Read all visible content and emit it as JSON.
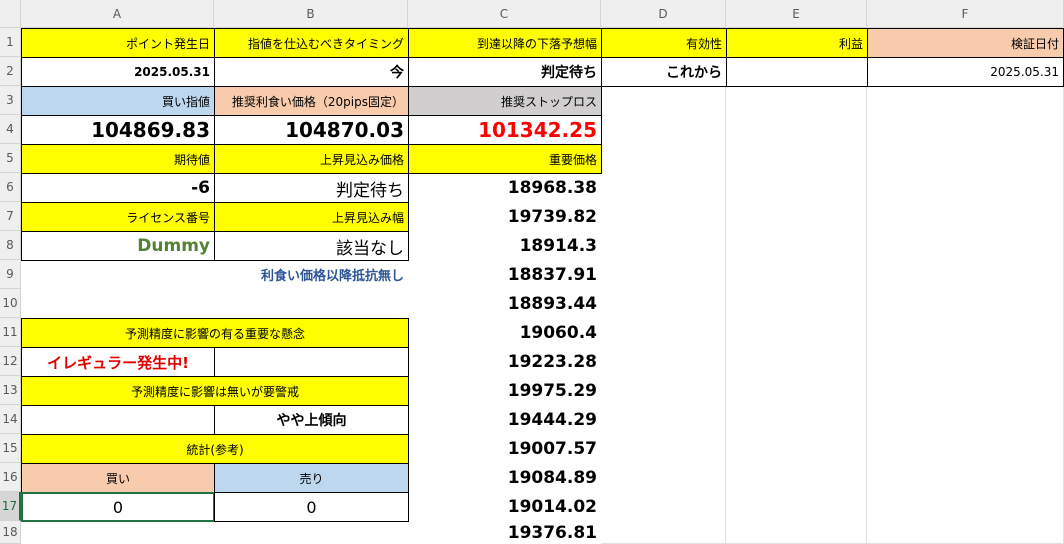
{
  "columns": [
    "A",
    "B",
    "C",
    "D",
    "E",
    "F"
  ],
  "rows": [
    "1",
    "2",
    "3",
    "4",
    "5",
    "6",
    "7",
    "8",
    "9",
    "10",
    "11",
    "12",
    "13",
    "14",
    "15",
    "16",
    "17",
    "18"
  ],
  "row1": {
    "a": "ポイント発生日",
    "b": "指値を仕込むべきタイミング",
    "c": "到達以降の下落予想幅",
    "d": "有効性",
    "e": "利益",
    "f": "検証日付"
  },
  "row2": {
    "a": "2025.05.31",
    "b": "今",
    "c": "判定待ち",
    "d": "これから",
    "f": "2025.05.31"
  },
  "row3": {
    "a": "買い指値",
    "b": "推奨利食い価格（20pips固定）",
    "c": "推奨ストップロス"
  },
  "row4": {
    "a": "104869.83",
    "b": "104870.03",
    "c": "101342.25"
  },
  "row5": {
    "a": "期待値",
    "b": "上昇見込み価格",
    "c": "重要価格"
  },
  "row6": {
    "a": "-6",
    "b": "判定待ち"
  },
  "row7": {
    "a": "ライセンス番号",
    "b": "上昇見込み幅"
  },
  "row8": {
    "a": "Dummy",
    "b": "該当なし"
  },
  "row9": {
    "ab": "利食い価格以降抵抗無し"
  },
  "row11": {
    "ab": "予測精度に影響の有る重要な懸念"
  },
  "row12": {
    "a": "イレギュラー発生中!"
  },
  "row13": {
    "ab": "予測精度に影響は無いが要警戒"
  },
  "row14": {
    "b": "やや上傾向"
  },
  "row15": {
    "ab": "統計(参考)"
  },
  "row16": {
    "a": "買い",
    "b": "売り"
  },
  "row17": {
    "a": "0",
    "b": "0"
  },
  "important_prices": [
    "18968.38",
    "19739.82",
    "18914.3",
    "18837.91",
    "18893.44",
    "19060.4",
    "19223.28",
    "19975.29",
    "19444.29",
    "19007.57",
    "19084.89",
    "19014.02",
    "19376.81"
  ],
  "colors": {
    "yellow": "#ffff00",
    "blue": "#bdd7ee",
    "peach": "#f8cbad",
    "gray": "#d0cece",
    "red": "#ff0000",
    "green": "#548235",
    "selection": "#217346"
  }
}
